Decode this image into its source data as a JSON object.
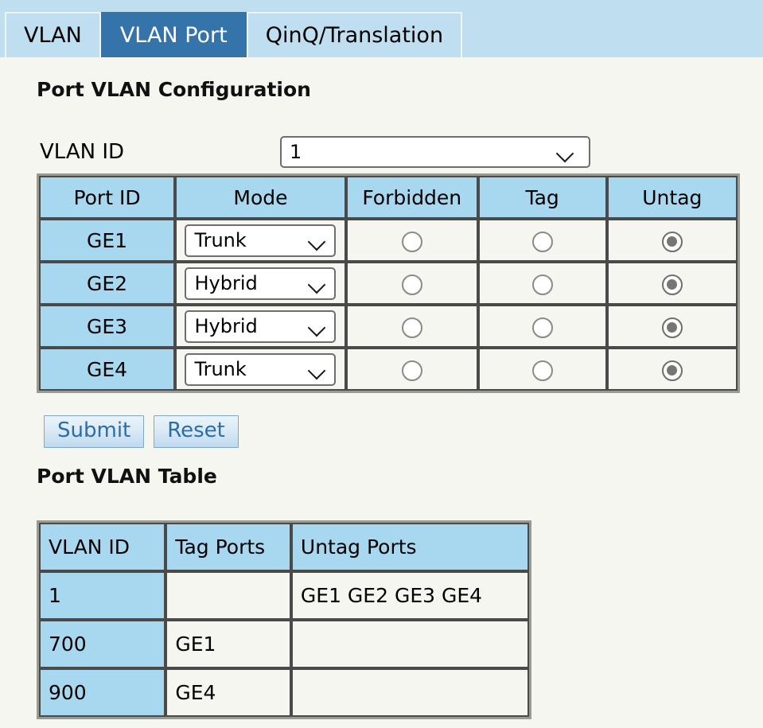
{
  "tabs": [
    {
      "label": "VLAN",
      "active": false
    },
    {
      "label": "VLAN Port",
      "active": true
    },
    {
      "label": "QinQ/Translation",
      "active": false
    }
  ],
  "headings": {
    "config": "Port VLAN Configuration",
    "table": "Port VLAN Table"
  },
  "vlan_id_field": {
    "label": "VLAN ID",
    "value": "1"
  },
  "config_table": {
    "columns": [
      "Port ID",
      "Mode",
      "Forbidden",
      "Tag",
      "Untag"
    ],
    "rows": [
      {
        "port": "GE1",
        "mode": "Trunk",
        "forbidden": false,
        "tag": false,
        "untag": true
      },
      {
        "port": "GE2",
        "mode": "Hybrid",
        "forbidden": false,
        "tag": false,
        "untag": true
      },
      {
        "port": "GE3",
        "mode": "Hybrid",
        "forbidden": false,
        "tag": false,
        "untag": true
      },
      {
        "port": "GE4",
        "mode": "Trunk",
        "forbidden": false,
        "tag": false,
        "untag": true
      }
    ]
  },
  "buttons": {
    "submit": "Submit",
    "reset": "Reset"
  },
  "port_vlan_table": {
    "columns": [
      "VLAN ID",
      "Tag Ports",
      "Untag Ports"
    ],
    "rows": [
      {
        "vlan_id": "1",
        "tag_ports": "",
        "untag_ports": "GE1 GE2 GE3 GE4"
      },
      {
        "vlan_id": "700",
        "tag_ports": "GE1",
        "untag_ports": ""
      },
      {
        "vlan_id": "900",
        "tag_ports": "GE4",
        "untag_ports": ""
      }
    ]
  },
  "colors": {
    "tabstrip_bg": "#bfdff0",
    "tab_active_bg": "#3574ab",
    "page_bg": "#f5f6ef",
    "header_cell_bg": "#a8d7f0",
    "button_text": "#2a6ea8"
  }
}
